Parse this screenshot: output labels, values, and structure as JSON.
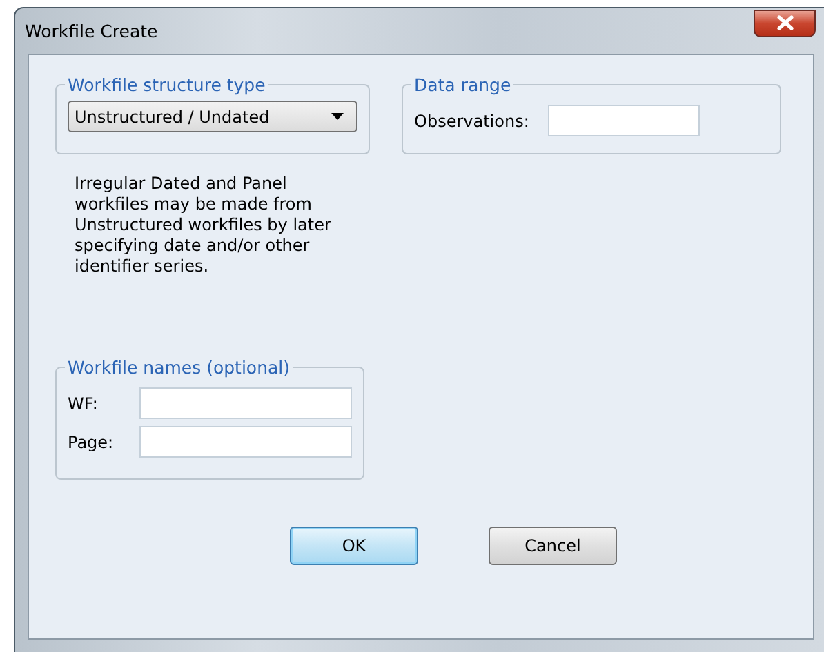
{
  "window": {
    "title": "Workfile Create"
  },
  "structure_group": {
    "title": "Workfile structure type",
    "dropdown": {
      "value": "Unstructured / Undated"
    },
    "note": "Irregular Dated and Panel workfiles may be made from Unstructured workfiles by later specifying date and/or other identifier series."
  },
  "data_range_group": {
    "title": "Data range",
    "fields": [
      {
        "label": "Observations:"
      }
    ]
  },
  "names_group": {
    "title": "Workfile names (optional)",
    "fields": [
      {
        "label": "WF:"
      },
      {
        "label": "Page:"
      }
    ]
  },
  "buttons": [
    {
      "label": "OK",
      "default": true
    },
    {
      "label": "Cancel",
      "default": false
    }
  ]
}
